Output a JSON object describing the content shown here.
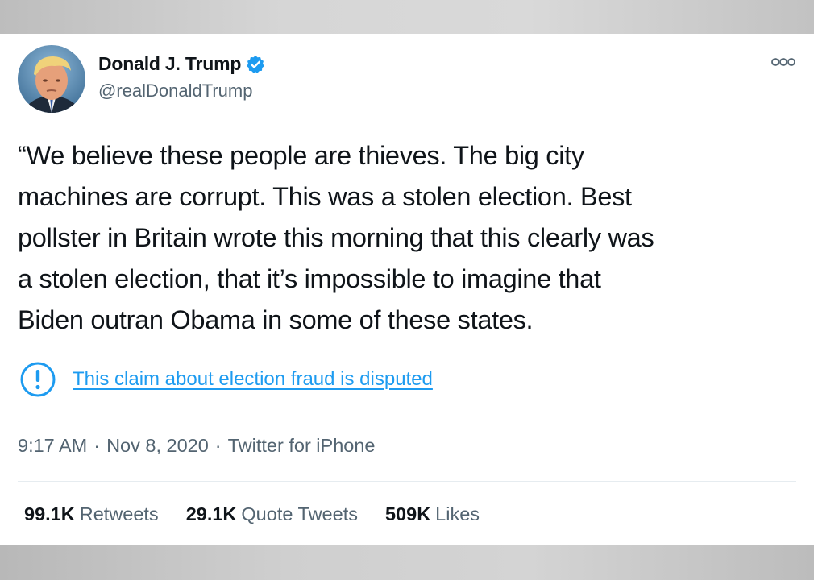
{
  "author": {
    "name": "Donald J. Trump",
    "handle": "@realDonaldTrump",
    "verified": true
  },
  "tweet": {
    "lines": [
      "“We believe these people are thieves. The big city",
      "machines are corrupt. This was a stolen election. Best",
      "pollster in Britain wrote this morning that this clearly was",
      "a stolen election, that it’s impossible to imagine that",
      "Biden outran Obama in some of these states."
    ]
  },
  "notice": {
    "icon": "exclamation-circle-icon",
    "text": "This claim about election fraud is disputed"
  },
  "meta": {
    "time": "9:17 AM",
    "date": "Nov 8, 2020",
    "source": "Twitter for iPhone",
    "separator": "·"
  },
  "stats": {
    "retweets_count": "99.1K",
    "retweets_label": "Retweets",
    "quotes_count": "29.1K",
    "quotes_label": "Quote Tweets",
    "likes_count": "509K",
    "likes_label": "Likes"
  },
  "colors": {
    "accent": "#1d9bf0",
    "text": "#0f1419",
    "secondary": "#536471"
  }
}
